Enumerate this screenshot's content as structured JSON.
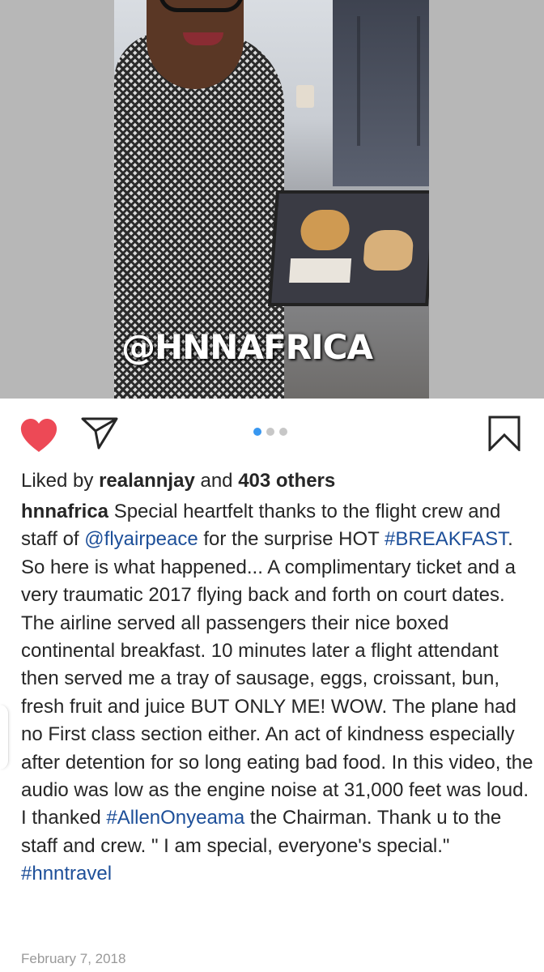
{
  "media": {
    "watermark": "@HNNAFRICA",
    "carousel": {
      "count": 3,
      "active_index": 0
    }
  },
  "actions": {
    "like_icon": "heart-icon",
    "share_icon": "paper-plane-icon",
    "save_icon": "bookmark-icon",
    "like_color": "#ed4956",
    "active_dot_color": "#3897f0"
  },
  "likes": {
    "prefix": "Liked by ",
    "user": "realannjay",
    "middle": " and ",
    "others": "403 others"
  },
  "caption": {
    "username": "hnnafrica",
    "text_1": " Special heartfelt thanks to the flight crew and staff of ",
    "mention": "@flyairpeace",
    "text_2": " for the surprise HOT ",
    "hashtag_1": "#BREAKFAST",
    "text_3": ". So here is what happened... A complimentary ticket and a very traumatic 2017 flying back and forth on court dates. The airline served all passengers their nice boxed continental breakfast. 10 minutes later a flight attendant then served me a tray of sausage, eggs, croissant, bun, fresh fruit and juice BUT ONLY ME! WOW. The plane had no First class section either. An act of kindness especially after detention for so long eating bad food. In this video, the audio was low as the engine noise at 31,000 feet was loud. I thanked ",
    "hashtag_2": "#AllenOnyeama",
    "text_4": " the Chairman. Thank u to the staff and crew. \" I am special, everyone's special.\"",
    "hashtag_3": "#hnntravel"
  },
  "date": "February 7, 2018"
}
